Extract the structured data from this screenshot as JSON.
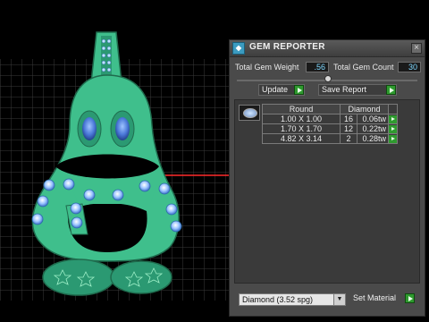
{
  "panel": {
    "title": "GEM REPORTER",
    "app_icon": "gem-app-icon",
    "close_icon": "close-icon",
    "total_gem_weight_label": "Total Gem Weight",
    "total_gem_weight_value": ".56",
    "total_gem_count_label": "Total Gem Count",
    "total_gem_count_value": "30",
    "update_label": "Update",
    "save_report_label": "Save Report",
    "table": {
      "headers": [
        "Round",
        "Diamond"
      ],
      "rows": [
        {
          "size": "1.00 X 1.00",
          "count": "16",
          "weight": "0.06tw"
        },
        {
          "size": "1.70 X 1.70",
          "count": "12",
          "weight": "0.22tw"
        },
        {
          "size": "4.82 X 3.14",
          "count": "2",
          "weight": "0.28tw"
        }
      ]
    },
    "material_select_value": "Diamond   (3.52 spg)",
    "set_material_label": "Set Material"
  },
  "colors": {
    "viewport_bg": "#000000",
    "grid": "#3a3a3a",
    "pendant": "#3fbf8c",
    "gem_blue": "#4a78d8",
    "axis_red": "#ff2a2a",
    "axis_cyan": "#23b7c9",
    "panel_bg": "#4a4a4a",
    "accent_green": "#2f9a2f"
  }
}
